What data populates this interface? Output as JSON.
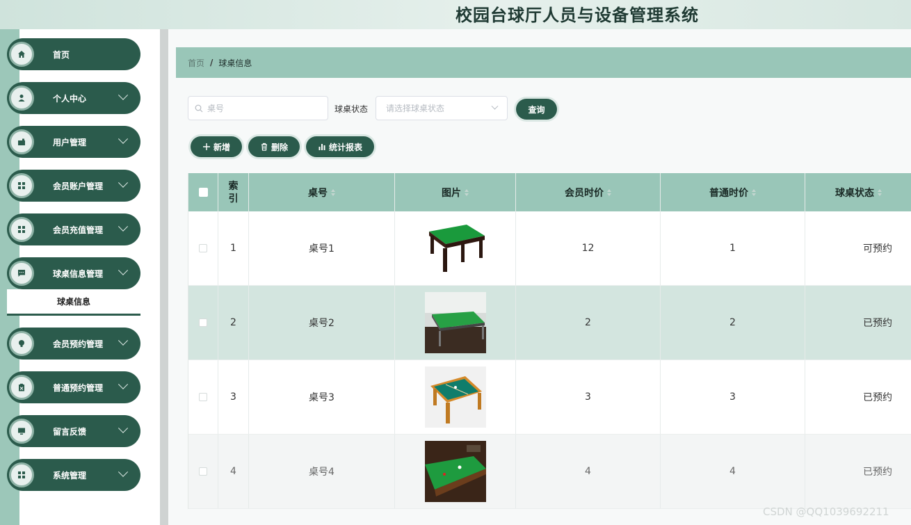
{
  "header": {
    "title": "校园台球厅人员与设备管理系统"
  },
  "sidebar": {
    "items": [
      {
        "label": "首页",
        "icon": "home-icon",
        "expandable": false
      },
      {
        "label": "个人中心",
        "icon": "user-icon",
        "expandable": true
      },
      {
        "label": "用户管理",
        "icon": "briefcase-icon",
        "expandable": true
      },
      {
        "label": "会员账户管理",
        "icon": "grid-icon",
        "expandable": true
      },
      {
        "label": "会员充值管理",
        "icon": "grid-icon",
        "expandable": true
      },
      {
        "label": "球桌信息管理",
        "icon": "chat-icon",
        "expandable": true
      },
      {
        "label": "会员预约管理",
        "icon": "bulb-icon",
        "expandable": true
      },
      {
        "label": "普通预约管理",
        "icon": "clipboard-icon",
        "expandable": true
      },
      {
        "label": "留言反馈",
        "icon": "monitor-icon",
        "expandable": true
      },
      {
        "label": "系统管理",
        "icon": "grid-icon",
        "expandable": true
      }
    ],
    "active_submenu": "球桌信息"
  },
  "breadcrumb": {
    "home": "首页",
    "separator": "/",
    "current": "球桌信息"
  },
  "search": {
    "table_no_placeholder": "桌号",
    "status_label": "球桌状态",
    "status_placeholder": "请选择球桌状态",
    "query_button": "查询"
  },
  "actions": {
    "add": "新增",
    "delete": "删除",
    "report": "统计报表"
  },
  "table": {
    "columns": [
      "索引",
      "桌号",
      "图片",
      "会员时价",
      "普通时价",
      "球桌状态"
    ],
    "rows": [
      {
        "index": "1",
        "table_no": "桌号1",
        "member_price": "12",
        "normal_price": "1",
        "status": "可预约"
      },
      {
        "index": "2",
        "table_no": "桌号2",
        "member_price": "2",
        "normal_price": "2",
        "status": "已预约"
      },
      {
        "index": "3",
        "table_no": "桌号3",
        "member_price": "3",
        "normal_price": "3",
        "status": "已预约"
      },
      {
        "index": "4",
        "table_no": "桌号4",
        "member_price": "4",
        "normal_price": "4",
        "status": "已预约"
      }
    ]
  },
  "watermark": "CSDN @QQ1039692211",
  "colors": {
    "primary": "#2b5b4c",
    "accent": "#99c6b8",
    "row_highlight": "#d3e5df"
  }
}
